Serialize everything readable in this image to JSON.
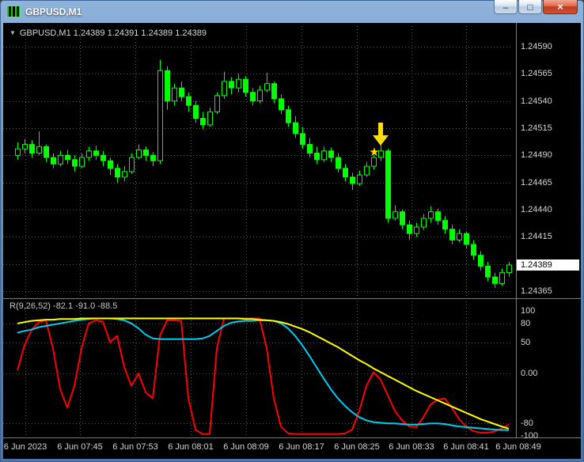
{
  "window": {
    "title": "GBPUSD,M1",
    "minimize_glyph": "–",
    "maximize_glyph": "□",
    "close_glyph": "×"
  },
  "chart_header": {
    "toggle_glyph": "▼",
    "info_line": "GBPUSD,M1  1.24389 1.24391 1.24389 1.24389"
  },
  "indicator_header": {
    "info_line": "R(9,26,52) -82.1 -91.0 -88.5"
  },
  "colors": {
    "background": "#000000",
    "grid": "#575757",
    "separator": "#7a7a7a",
    "axis_text": "#d6d6d6"
  },
  "chart_data": [
    {
      "type": "candlestick",
      "symbol": "GBPUSD,M1",
      "timeframe": "M1",
      "ohlc_current": {
        "open": "1.24389",
        "high": "1.24391",
        "low": "1.24389",
        "close": "1.24389"
      },
      "current_price": "1.24389",
      "ylim": [
        1.24358,
        1.24609
      ],
      "y_ticks": [
        "1.24590",
        "1.24565",
        "1.24540",
        "1.24515",
        "1.24490",
        "1.24465",
        "1.24440",
        "1.24415",
        "1.24365"
      ],
      "grid_prices": [
        1.2459,
        1.24565,
        1.2454,
        1.24515,
        1.2449,
        1.24465,
        1.2444,
        1.24415,
        1.2439,
        1.24365
      ],
      "x_ticks": [
        "6 Jun 2023",
        "6 Jun 07:45",
        "6 Jun 07:53",
        "6 Jun 08:01",
        "6 Jun 08:09",
        "6 Jun 08:17",
        "6 Jun 08:25",
        "6 Jun 08:33",
        "6 Jun 08:41",
        "6 Jun 08:49"
      ],
      "colors": {
        "outline": "#00FF00",
        "bull_fill": "#000000"
      },
      "annotations": {
        "arrow": {
          "type": "sell-arrow-down",
          "color": "#FFDD00",
          "candle_index": 51
        },
        "star": {
          "type": "star",
          "glyph": "★",
          "color": "#FFDD00",
          "candle_index": 50
        }
      },
      "candles": [
        [
          1.2449,
          1.24502,
          1.24486,
          1.24496
        ],
        [
          1.24496,
          1.24505,
          1.24492,
          1.245
        ],
        [
          1.245,
          1.24504,
          1.24488,
          1.24492
        ],
        [
          1.24492,
          1.24512,
          1.2449,
          1.24498
        ],
        [
          1.24498,
          1.245,
          1.24484,
          1.24488
        ],
        [
          1.24488,
          1.24492,
          1.24478,
          1.24482
        ],
        [
          1.24482,
          1.24494,
          1.2448,
          1.2449
        ],
        [
          1.2449,
          1.24495,
          1.24482,
          1.24486
        ],
        [
          1.24486,
          1.2449,
          1.24475,
          1.2448
        ],
        [
          1.2448,
          1.24492,
          1.24478,
          1.24488
        ],
        [
          1.24488,
          1.24498,
          1.24485,
          1.24494
        ],
        [
          1.24494,
          1.24499,
          1.24486,
          1.2449
        ],
        [
          1.2449,
          1.24494,
          1.2448,
          1.24485
        ],
        [
          1.24485,
          1.24488,
          1.24472,
          1.24478
        ],
        [
          1.24478,
          1.24482,
          1.24465,
          1.2447
        ],
        [
          1.2447,
          1.2448,
          1.24466,
          1.24475
        ],
        [
          1.24475,
          1.24492,
          1.24473,
          1.24488
        ],
        [
          1.24488,
          1.245,
          1.24486,
          1.24495
        ],
        [
          1.24495,
          1.24498,
          1.24485,
          1.2449
        ],
        [
          1.2449,
          1.24493,
          1.2448,
          1.24485
        ],
        [
          1.24485,
          1.24578,
          1.24482,
          1.24568
        ],
        [
          1.24568,
          1.24572,
          1.24532,
          1.2454
        ],
        [
          1.2454,
          1.24556,
          1.24536,
          1.24552
        ],
        [
          1.24552,
          1.24558,
          1.2454,
          1.24544
        ],
        [
          1.24544,
          1.24548,
          1.2453,
          1.24536
        ],
        [
          1.24536,
          1.2454,
          1.2452,
          1.24524
        ],
        [
          1.24524,
          1.2453,
          1.24514,
          1.24518
        ],
        [
          1.24518,
          1.24534,
          1.24516,
          1.2453
        ],
        [
          1.2453,
          1.24548,
          1.24528,
          1.24545
        ],
        [
          1.24545,
          1.24567,
          1.24542,
          1.24558
        ],
        [
          1.24558,
          1.24562,
          1.24546,
          1.24552
        ],
        [
          1.24552,
          1.24565,
          1.24548,
          1.2456
        ],
        [
          1.2456,
          1.24563,
          1.24544,
          1.24548
        ],
        [
          1.24548,
          1.24552,
          1.24536,
          1.2454
        ],
        [
          1.2454,
          1.24554,
          1.24538,
          1.2455
        ],
        [
          1.2455,
          1.24566,
          1.24548,
          1.24556
        ],
        [
          1.24556,
          1.24558,
          1.24538,
          1.24542
        ],
        [
          1.24542,
          1.24546,
          1.24528,
          1.24532
        ],
        [
          1.24532,
          1.24536,
          1.24516,
          1.2452
        ],
        [
          1.2452,
          1.24526,
          1.24506,
          1.2451
        ],
        [
          1.2451,
          1.24516,
          1.24496,
          1.245
        ],
        [
          1.245,
          1.24506,
          1.24488,
          1.24492
        ],
        [
          1.24492,
          1.24498,
          1.24482,
          1.24486
        ],
        [
          1.24486,
          1.24498,
          1.24484,
          1.24494
        ],
        [
          1.24494,
          1.24497,
          1.24484,
          1.24488
        ],
        [
          1.24488,
          1.24492,
          1.24474,
          1.24478
        ],
        [
          1.24478,
          1.24482,
          1.24466,
          1.2447
        ],
        [
          1.2447,
          1.24474,
          1.24458,
          1.24464
        ],
        [
          1.24464,
          1.24476,
          1.24462,
          1.24472
        ],
        [
          1.24472,
          1.24484,
          1.2447,
          1.2448
        ],
        [
          1.2448,
          1.2449,
          1.24477,
          1.24488
        ],
        [
          1.24488,
          1.245,
          1.24485,
          1.24494
        ],
        [
          1.24494,
          1.24496,
          1.24428,
          1.24432
        ],
        [
          1.24432,
          1.24444,
          1.2443,
          1.24438
        ],
        [
          1.24438,
          1.2444,
          1.24422,
          1.24426
        ],
        [
          1.24426,
          1.2443,
          1.24412,
          1.24418
        ],
        [
          1.24418,
          1.24428,
          1.24415,
          1.24424
        ],
        [
          1.24424,
          1.24436,
          1.24421,
          1.24432
        ],
        [
          1.24432,
          1.24443,
          1.24428,
          1.24438
        ],
        [
          1.24438,
          1.24441,
          1.24426,
          1.2443
        ],
        [
          1.2443,
          1.24434,
          1.24418,
          1.24422
        ],
        [
          1.24422,
          1.24426,
          1.24408,
          1.24412
        ],
        [
          1.24412,
          1.24422,
          1.2441,
          1.24418
        ],
        [
          1.24418,
          1.2442,
          1.24404,
          1.24408
        ],
        [
          1.24408,
          1.24412,
          1.24394,
          1.24398
        ],
        [
          1.24398,
          1.24402,
          1.24384,
          1.24388
        ],
        [
          1.24388,
          1.24392,
          1.24374,
          1.24378
        ],
        [
          1.24378,
          1.24382,
          1.24368,
          1.24372
        ],
        [
          1.24372,
          1.24386,
          1.2437,
          1.24382
        ],
        [
          1.24382,
          1.24392,
          1.24378,
          1.24389
        ]
      ]
    },
    {
      "type": "line",
      "label": "R(9,26,52) -82.1 -91.0 -88.5",
      "ylim": [
        -102.5,
        117
      ],
      "y_ticks": [
        "100",
        "80",
        "50",
        "0.00",
        "-80",
        "-100"
      ],
      "level_lines": [
        80,
        50,
        0,
        -80
      ],
      "series": [
        {
          "name": "R9",
          "color": "#FF0000",
          "width": 2,
          "last_value": -82.1,
          "values": [
            5,
            45,
            70,
            82,
            85,
            40,
            -25,
            -55,
            -20,
            40,
            80,
            85,
            83,
            50,
            60,
            10,
            -20,
            0,
            -30,
            -40,
            60,
            85,
            85,
            84,
            -40,
            -90,
            -97,
            -97,
            40,
            88,
            88,
            88,
            88,
            88,
            88,
            40,
            -40,
            -85,
            -96,
            -97,
            -97,
            -97,
            -97,
            -97,
            -97,
            -97,
            -96,
            -90,
            -60,
            -20,
            2,
            -10,
            -35,
            -60,
            -75,
            -85,
            -86,
            -70,
            -50,
            -42,
            -40,
            -55,
            -73,
            -85,
            -92,
            -95,
            -95,
            -93,
            -88,
            -82.1
          ]
        },
        {
          "name": "R26",
          "color": "#00CCEE",
          "width": 2,
          "last_value": -91.0,
          "values": [
            65,
            68,
            70,
            74,
            76,
            78,
            80,
            82,
            84,
            86,
            87,
            88,
            88,
            88,
            87,
            85,
            80,
            72,
            62,
            56,
            55,
            55,
            55,
            55,
            55,
            55,
            56,
            60,
            68,
            76,
            81,
            83,
            84,
            84,
            85,
            85,
            84,
            80,
            72,
            60,
            45,
            28,
            10,
            -8,
            -25,
            -40,
            -52,
            -62,
            -70,
            -75,
            -78,
            -79,
            -80,
            -80,
            -81,
            -82,
            -82,
            -81,
            -80,
            -80,
            -81,
            -83,
            -85,
            -86,
            -87,
            -88,
            -89,
            -90,
            -90.5,
            -91
          ]
        },
        {
          "name": "R52",
          "color": "#FFFF00",
          "width": 2,
          "last_value": -88.5,
          "values": [
            80,
            82,
            84,
            85,
            86,
            86,
            87,
            87,
            87,
            88,
            88,
            88,
            88,
            88,
            88,
            88,
            88,
            88,
            88,
            88,
            88,
            88,
            88,
            88,
            88,
            88,
            88,
            88,
            88,
            88,
            88,
            88,
            87,
            87,
            86,
            85,
            84,
            82,
            79,
            75,
            71,
            66,
            60,
            54,
            48,
            42,
            35,
            28,
            21,
            15,
            8,
            2,
            -4,
            -10,
            -16,
            -22,
            -28,
            -33,
            -38,
            -43,
            -48,
            -53,
            -58,
            -63,
            -68,
            -73,
            -77,
            -81,
            -85,
            -88.5
          ]
        }
      ]
    }
  ]
}
